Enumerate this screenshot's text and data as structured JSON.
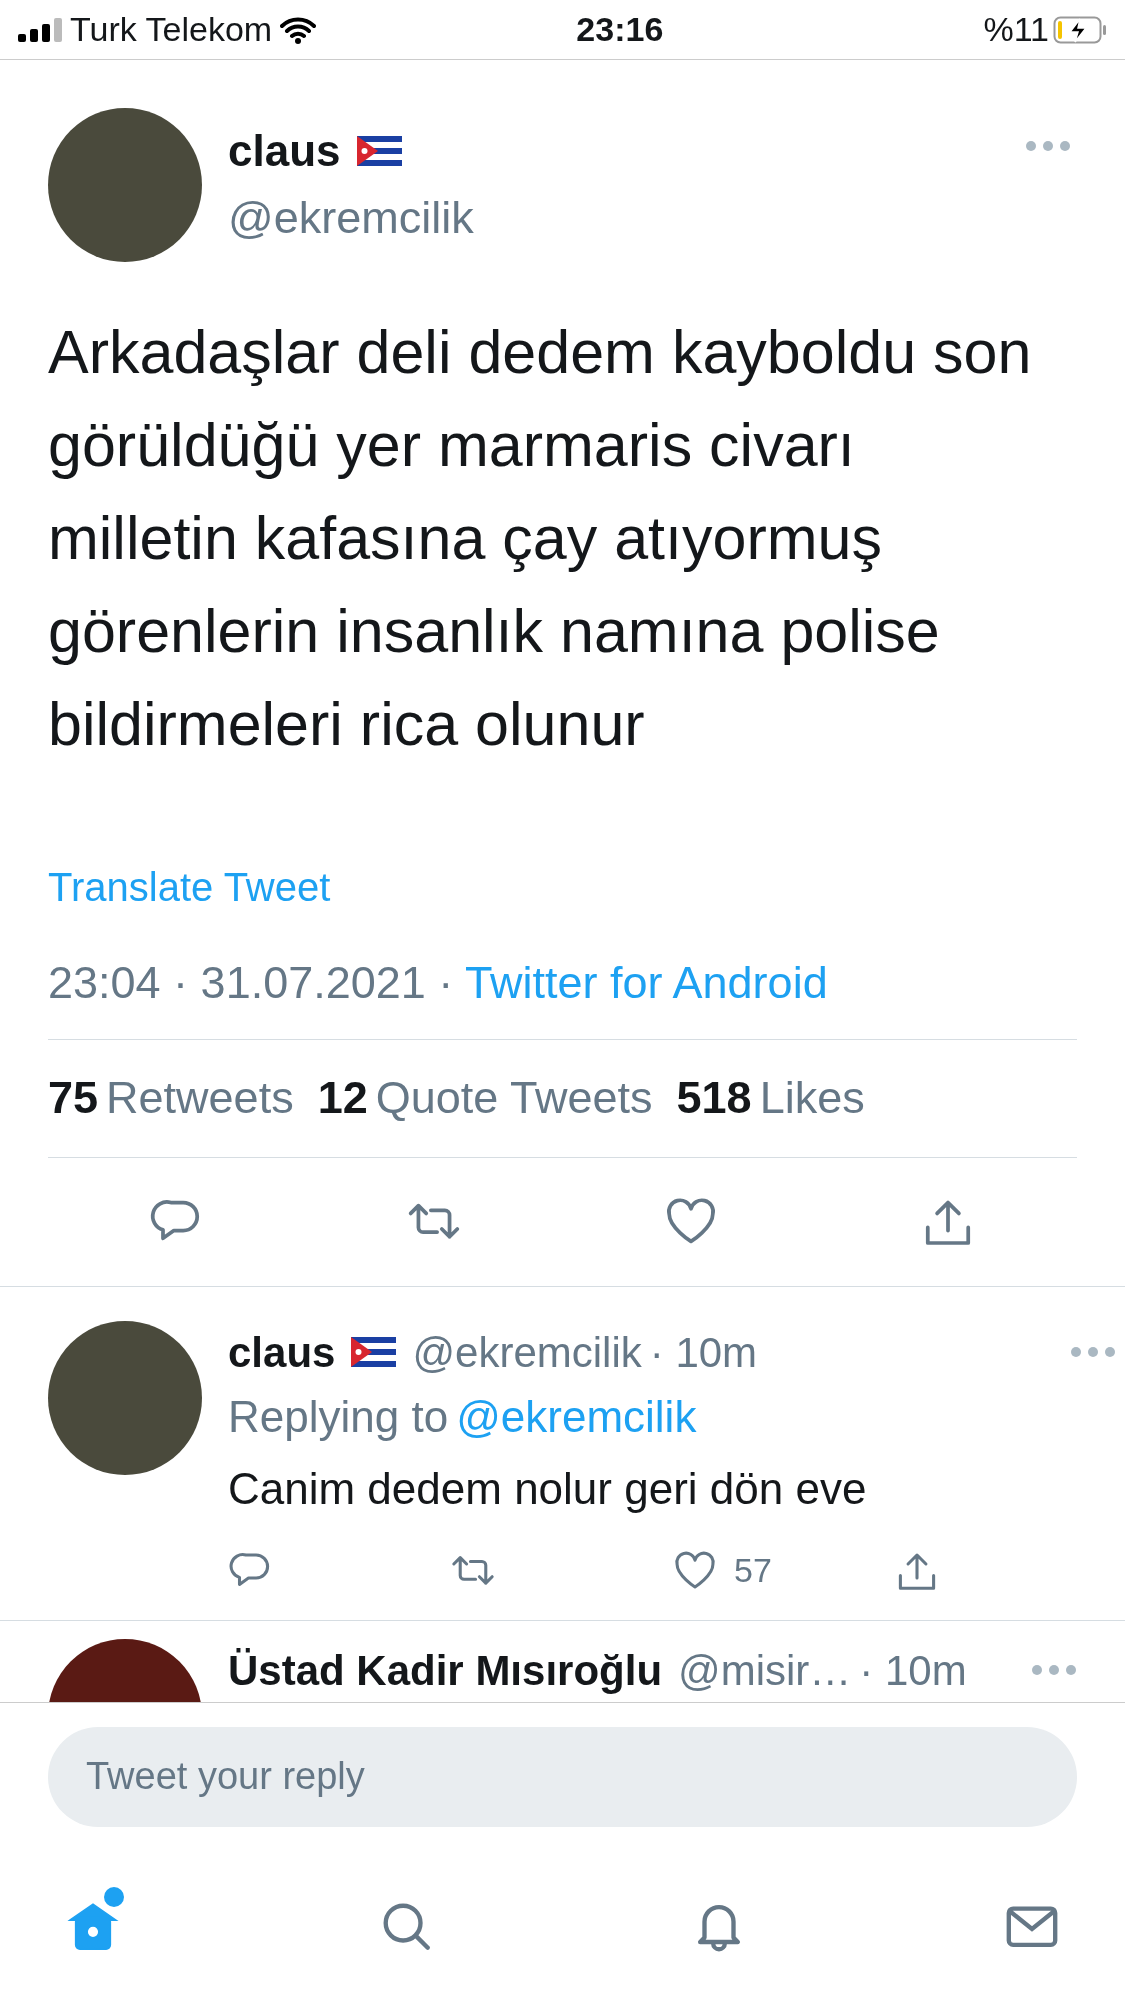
{
  "status_bar": {
    "carrier": "Turk Telekom",
    "time": "23:16",
    "battery_text": "%11",
    "battery": {
      "level": 0.11,
      "charging": true
    }
  },
  "tweet": {
    "name": "claus",
    "handle": "@ekremcilik",
    "text": "Arkadaşlar deli dedem kayboldu son görüldüğü yer marmaris civarı milletin kafasına çay atıyormuş görenlerin insanlık namına polise bildirmeleri rica olunur",
    "translate": "Translate Tweet",
    "timestamp": "23:04 · 31.07.2021 · ",
    "source": "Twitter for Android",
    "stats": [
      {
        "count": "75",
        "label": "Retweets"
      },
      {
        "count": "12",
        "label": "Quote Tweets"
      },
      {
        "count": "518",
        "label": "Likes"
      }
    ]
  },
  "replies": [
    {
      "name": "claus",
      "flag": true,
      "handle": "@ekremcilik",
      "time": "· 10m",
      "replying_prefix": "Replying to",
      "replying_handle": "@ekremcilik",
      "text": "Canim dedem nolur geri dön eve",
      "like_count": "57"
    },
    {
      "name": "Üstad Kadir Mısıroğlu",
      "handle": "@misir…",
      "time": "· 10m"
    }
  ],
  "reply_field": {
    "placeholder": "Tweet your reply"
  },
  "nav": [
    {
      "kind": "home",
      "selected": true,
      "has_new": true
    },
    {
      "kind": "search",
      "selected": false
    },
    {
      "kind": "notifications",
      "selected": false
    },
    {
      "kind": "messages",
      "selected": false
    }
  ]
}
